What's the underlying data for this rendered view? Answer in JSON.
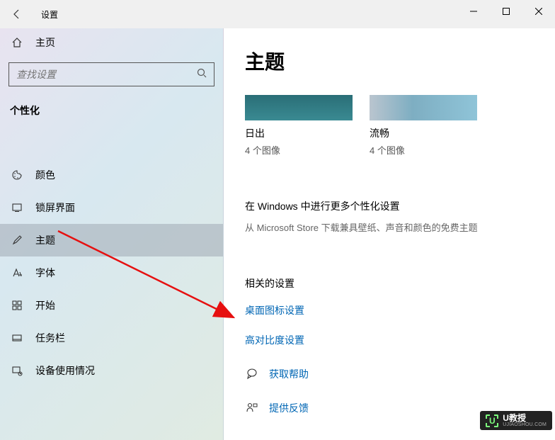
{
  "titlebar": {
    "title": "设置"
  },
  "sidebar": {
    "home_label": "主页",
    "search_placeholder": "查找设置",
    "section": "个性化",
    "items": [
      {
        "label": "颜色"
      },
      {
        "label": "锁屏界面"
      },
      {
        "label": "主题"
      },
      {
        "label": "字体"
      },
      {
        "label": "开始"
      },
      {
        "label": "任务栏"
      },
      {
        "label": "设备使用情况"
      }
    ]
  },
  "content": {
    "page_title": "主题",
    "themes": [
      {
        "name": "日出",
        "count": "4 个图像"
      },
      {
        "name": "流畅",
        "count": "4 个图像"
      }
    ],
    "more_title": "在 Windows 中进行更多个性化设置",
    "more_sub": "从 Microsoft Store 下载兼具壁纸、声音和颜色的免费主题",
    "related_title": "相关的设置",
    "link_desktop_icons": "桌面图标设置",
    "link_high_contrast": "高对比度设置",
    "get_help": "获取帮助",
    "give_feedback": "提供反馈"
  },
  "watermark": {
    "brand": "U教授",
    "url": "UJIAOSHOU.COM"
  }
}
